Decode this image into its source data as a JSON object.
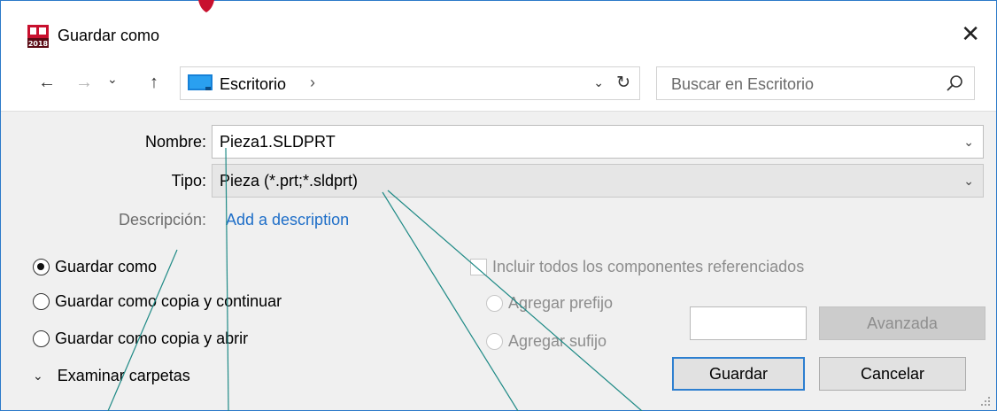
{
  "window": {
    "title": "Guardar como",
    "close_glyph": "✕",
    "app_icon": "solidworks-2018-icon",
    "app_icon_text": "2018"
  },
  "nav": {
    "back_glyph": "←",
    "forward_glyph": "→",
    "recent_glyph": "⌄",
    "up_glyph": "↑",
    "path": "Escritorio",
    "path_separator": "›",
    "dropdown_glyph": "⌄",
    "refresh_glyph": "↻",
    "search_placeholder": "Buscar en Escritorio"
  },
  "form": {
    "name_label": "Nombre:",
    "name_value": "Pieza1.SLDPRT",
    "type_label": "Tipo:",
    "type_value": "Pieza (*.prt;*.sldprt)",
    "chevron": "⌄",
    "desc_label": "Descripción:",
    "desc_link": "Add a description"
  },
  "options": {
    "save_as": "Guardar como",
    "save_copy_continue": "Guardar como copia y continuar",
    "save_copy_open": "Guardar como copia y abrir",
    "include_refs": "Incluir todos los componentes referenciados",
    "add_prefix": "Agregar prefijo",
    "add_suffix": "Agregar sufijo",
    "selected": "save_as"
  },
  "buttons": {
    "advanced": "Avanzada",
    "save": "Guardar",
    "cancel": "Cancelar"
  },
  "browse": {
    "chevron": "⌄",
    "label": "Examinar carpetas"
  },
  "colors": {
    "accent": "#2d7fd0",
    "link": "#1e6ec8",
    "annotation": "#1f8a86",
    "marker": "#c8102e"
  }
}
